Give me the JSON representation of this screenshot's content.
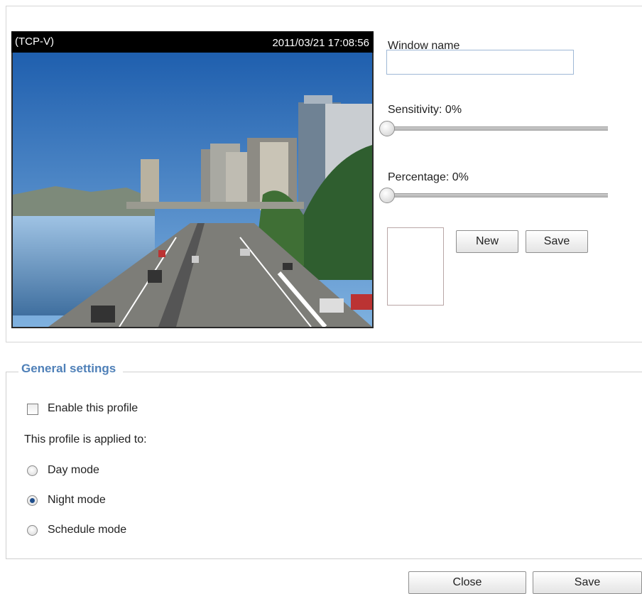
{
  "video": {
    "protocol": "(TCP-V)",
    "timestamp": "2011/03/21  17:08:56"
  },
  "window_name": {
    "label": "Window name",
    "value": ""
  },
  "sensitivity": {
    "label": "Sensitivity: 0%",
    "value_percent": 0
  },
  "percentage": {
    "label": "Percentage: 0%",
    "value_percent": 0
  },
  "buttons": {
    "new": "New",
    "save": "Save"
  },
  "general": {
    "title": "General settings",
    "enable_label": "Enable this profile",
    "enable_checked": false,
    "applied_to_label": "This profile is applied to:",
    "modes": [
      {
        "label": "Day mode",
        "checked": false
      },
      {
        "label": "Night mode",
        "checked": true
      },
      {
        "label": "Schedule mode",
        "checked": false
      }
    ]
  },
  "footer": {
    "close": "Close",
    "save": "Save"
  },
  "colors": {
    "accent": "#4f80b8",
    "radio_selected": "#1f4e8c"
  }
}
